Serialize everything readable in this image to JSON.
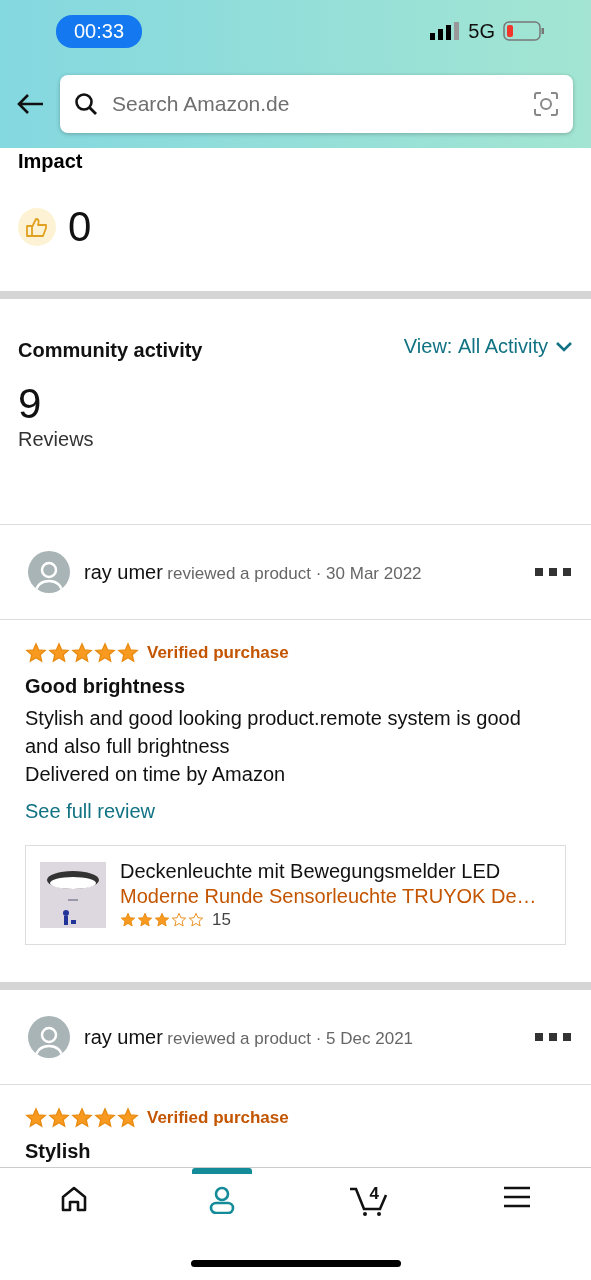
{
  "status_bar": {
    "time": "00:33",
    "network": "5G"
  },
  "search": {
    "placeholder": "Search Amazon.de"
  },
  "impact": {
    "title": "Impact",
    "count": "0"
  },
  "community": {
    "title": "Community activity",
    "view_label": "View:",
    "view_value": "All Activity",
    "count": "9",
    "count_label": "Reviews"
  },
  "reviews": [
    {
      "author": "ray umer",
      "action": "reviewed a product · 30 Mar 2022",
      "stars": 5,
      "badge": "Verified purchase",
      "title": "Good brightness",
      "body": "Stylish and good looking product.remote system is good and also full brightness",
      "delivery": "Delivered on time by Amazon",
      "link": "See full review",
      "product": {
        "name": "Deckenleuchte mit Bewegungsmelder LED",
        "subtitle": "Moderne Runde Sensorleuchte TRUYOK De…",
        "stars": 3,
        "ratings": "15"
      }
    },
    {
      "author": "ray umer",
      "action": "reviewed a product · 5 Dec 2021",
      "stars": 5,
      "badge": "Verified purchase",
      "title": "Stylish"
    }
  ],
  "nav": [
    {
      "kind": "home",
      "selected": false
    },
    {
      "kind": "account",
      "selected": true
    },
    {
      "kind": "cart",
      "selected": false,
      "count": "4"
    },
    {
      "kind": "menu",
      "selected": false
    }
  ]
}
